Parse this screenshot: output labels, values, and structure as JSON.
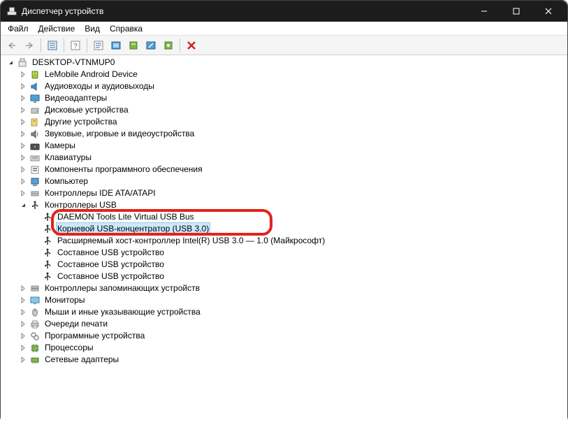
{
  "window": {
    "title": "Диспетчер устройств"
  },
  "menu": {
    "file": "Файл",
    "action": "Действие",
    "view": "Вид",
    "help": "Справка"
  },
  "tree": {
    "root": "DESKTOP-VTNMUP0",
    "items": [
      {
        "label": "LeMobile Android Device",
        "icon": "android",
        "children": false
      },
      {
        "label": "Аудиовходы и аудиовыходы",
        "icon": "audio",
        "children": false
      },
      {
        "label": "Видеоадаптеры",
        "icon": "display",
        "children": false
      },
      {
        "label": "Дисковые устройства",
        "icon": "disk",
        "children": false
      },
      {
        "label": "Другие устройства",
        "icon": "other",
        "children": false
      },
      {
        "label": "Звуковые, игровые и видеоустройства",
        "icon": "sound",
        "children": false
      },
      {
        "label": "Камеры",
        "icon": "camera",
        "children": false
      },
      {
        "label": "Клавиатуры",
        "icon": "keyboard",
        "children": false
      },
      {
        "label": "Компоненты программного обеспечения",
        "icon": "software",
        "children": false
      },
      {
        "label": "Компьютер",
        "icon": "computer",
        "children": false
      },
      {
        "label": "Контроллеры IDE ATA/ATAPI",
        "icon": "ide",
        "children": false
      },
      {
        "label": "Контроллеры USB",
        "icon": "usb",
        "expanded": true,
        "children": [
          {
            "label": "DAEMON Tools Lite Virtual USB Bus",
            "icon": "usb"
          },
          {
            "label": "Корневой USB-концентратор (USB 3.0)",
            "icon": "usb",
            "selected": true
          },
          {
            "label": "Расширяемый хост-контроллер Intel(R) USB 3.0 — 1.0 (Майкрософт)",
            "icon": "usb"
          },
          {
            "label": "Составное USB устройство",
            "icon": "usb"
          },
          {
            "label": "Составное USB устройство",
            "icon": "usb"
          },
          {
            "label": "Составное USB устройство",
            "icon": "usb"
          }
        ]
      },
      {
        "label": "Контроллеры запоминающих устройств",
        "icon": "storage",
        "children": false
      },
      {
        "label": "Мониторы",
        "icon": "monitor",
        "children": false
      },
      {
        "label": "Мыши и иные указывающие устройства",
        "icon": "mouse",
        "children": false
      },
      {
        "label": "Очереди печати",
        "icon": "printer",
        "children": false
      },
      {
        "label": "Программные устройства",
        "icon": "software2",
        "children": false
      },
      {
        "label": "Процессоры",
        "icon": "cpu",
        "children": false
      },
      {
        "label": "Сетевые адаптеры",
        "icon": "network",
        "children": false
      }
    ]
  }
}
